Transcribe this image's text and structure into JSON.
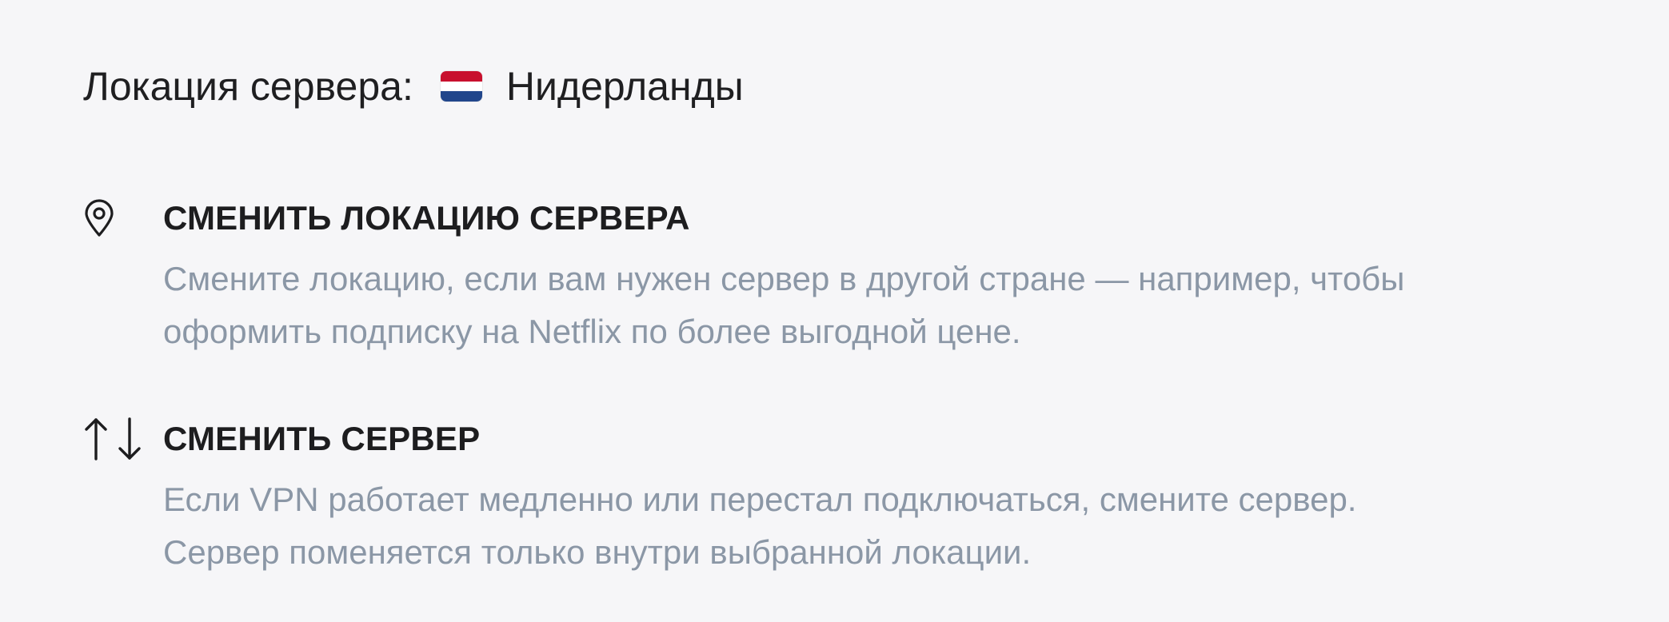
{
  "server": {
    "location_label": "Локация сервера:",
    "location_value": "Нидерланды",
    "flag": {
      "colors": [
        "#c8102e",
        "#ffffff",
        "#21468b"
      ],
      "icon": "netherlands-flag-icon"
    }
  },
  "actions": [
    {
      "title": "СМЕНИТЬ ЛОКАЦИЮ СЕРВЕРА",
      "icon": "map-pin-icon",
      "description_lines": [
        "Смените локацию, если вам нужен сервер в другой стране — например, чтобы",
        "оформить подписку на Netflix по более выгодной цене."
      ]
    },
    {
      "title": "СМЕНИТЬ СЕРВЕР",
      "icon": "swap-arrows-icon",
      "description_lines": [
        "Если VPN работает медленно или перестал подключаться, смените сервер.",
        "Сервер поменяется только внутри выбранной локации."
      ]
    }
  ],
  "colors": {
    "background": "#f6f6f8",
    "title_text": "#1d1d1f",
    "description_text": "#8b97a6"
  }
}
